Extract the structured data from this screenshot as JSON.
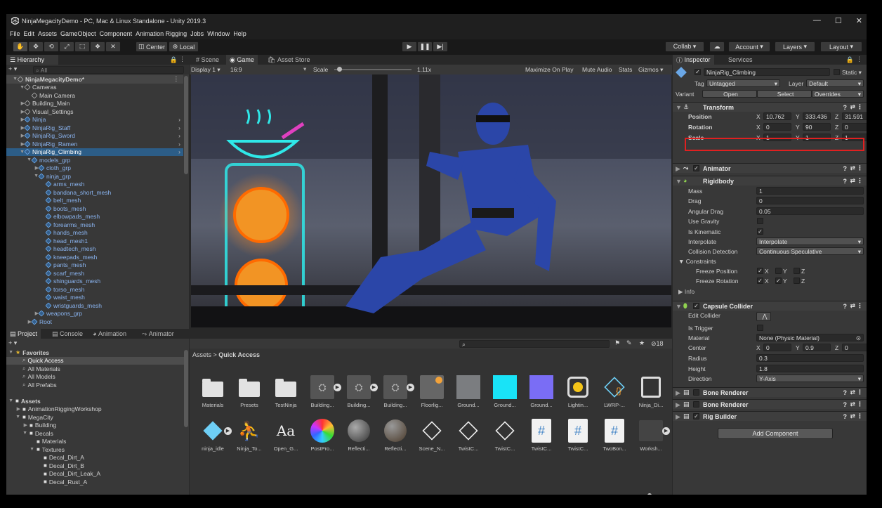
{
  "window": {
    "title": "NinjaMegacityDemo - PC, Mac & Linux Standalone - Unity 2019.3",
    "controls": [
      "—",
      "☐",
      "✕"
    ]
  },
  "menu": [
    "File",
    "Edit",
    "Assets",
    "GameObject",
    "Component",
    "Animation Rigging",
    "Jobs",
    "Window",
    "Help"
  ],
  "toolbar": {
    "pivot": "Center",
    "space": "Local",
    "collab": "Collab ▾",
    "account": "Account",
    "layers": "Layers",
    "layout": "Layout"
  },
  "hierarchy": {
    "tab": "Hierarchy",
    "search_placeholder": "All",
    "items": [
      {
        "label": "NinjaMegacityDemo*",
        "indent": 0,
        "bold": true,
        "arrow": "▼",
        "scene": true
      },
      {
        "label": "Cameras",
        "indent": 1,
        "arrow": "▼"
      },
      {
        "label": "Main Camera",
        "indent": 2,
        "arrow": ""
      },
      {
        "label": "Building_Main",
        "indent": 1,
        "arrow": "▶"
      },
      {
        "label": "Visual_Settings",
        "indent": 1,
        "arrow": "▶"
      },
      {
        "label": "Ninja",
        "indent": 1,
        "arrow": "▶",
        "blue": true,
        "more": true
      },
      {
        "label": "NinjaRig_Staff",
        "indent": 1,
        "arrow": "▶",
        "blue": true,
        "more": true
      },
      {
        "label": "NinjaRig_Sword",
        "indent": 1,
        "arrow": "▶",
        "blue": true,
        "more": true
      },
      {
        "label": "NinjaRig_Ramen",
        "indent": 1,
        "arrow": "▶",
        "blue": true,
        "more": true
      },
      {
        "label": "NinjaRig_Climbing",
        "indent": 1,
        "arrow": "▼",
        "blue": true,
        "selected": true,
        "more": true
      },
      {
        "label": "models_grp",
        "indent": 2,
        "arrow": "▼",
        "blue": true
      },
      {
        "label": "cloth_grp",
        "indent": 3,
        "arrow": "▶",
        "blue": true
      },
      {
        "label": "ninja_grp",
        "indent": 3,
        "arrow": "▼",
        "blue": true
      },
      {
        "label": "arms_mesh",
        "indent": 4,
        "arrow": "",
        "blue": true
      },
      {
        "label": "bandana_short_mesh",
        "indent": 4,
        "arrow": "",
        "blue": true
      },
      {
        "label": "belt_mesh",
        "indent": 4,
        "arrow": "",
        "blue": true
      },
      {
        "label": "boots_mesh",
        "indent": 4,
        "arrow": "",
        "blue": true
      },
      {
        "label": "elbowpads_mesh",
        "indent": 4,
        "arrow": "",
        "blue": true
      },
      {
        "label": "forearms_mesh",
        "indent": 4,
        "arrow": "",
        "blue": true
      },
      {
        "label": "hands_mesh",
        "indent": 4,
        "arrow": "",
        "blue": true
      },
      {
        "label": "head_mesh1",
        "indent": 4,
        "arrow": "",
        "blue": true
      },
      {
        "label": "headtech_mesh",
        "indent": 4,
        "arrow": "",
        "blue": true
      },
      {
        "label": "kneepads_mesh",
        "indent": 4,
        "arrow": "",
        "blue": true
      },
      {
        "label": "pants_mesh",
        "indent": 4,
        "arrow": "",
        "blue": true
      },
      {
        "label": "scarf_mesh",
        "indent": 4,
        "arrow": "",
        "blue": true
      },
      {
        "label": "shinguards_mesh",
        "indent": 4,
        "arrow": "",
        "blue": true
      },
      {
        "label": "torso_mesh",
        "indent": 4,
        "arrow": "",
        "blue": true
      },
      {
        "label": "waist_mesh",
        "indent": 4,
        "arrow": "",
        "blue": true
      },
      {
        "label": "wristguards_mesh",
        "indent": 4,
        "arrow": "",
        "blue": true
      },
      {
        "label": "weapons_grp",
        "indent": 3,
        "arrow": "▶",
        "blue": true
      },
      {
        "label": "Root",
        "indent": 2,
        "arrow": "▶",
        "blue": true
      }
    ]
  },
  "center_tabs": {
    "scene": "Scene",
    "game": "Game",
    "asset_store": "Asset Store"
  },
  "game_bar": {
    "display": "Display 1",
    "aspect": "16:9",
    "scale_label": "Scale",
    "scale_value": "1.11x",
    "maximize": "Maximize On Play",
    "mute": "Mute Audio",
    "stats": "Stats",
    "gizmos": "Gizmos"
  },
  "project": {
    "tabs": [
      "Project",
      "Console",
      "Animation",
      "Animator"
    ],
    "count": "18",
    "breadcrumb_root": "Assets",
    "breadcrumb_current": "Quick Access",
    "tree": [
      {
        "label": "Favorites",
        "indent": 0,
        "arrow": "▼",
        "star": true,
        "bold": true
      },
      {
        "label": "Quick Access",
        "indent": 1,
        "arrow": "",
        "selected": true
      },
      {
        "label": "All Materials",
        "indent": 1,
        "arrow": ""
      },
      {
        "label": "All Models",
        "indent": 1,
        "arrow": ""
      },
      {
        "label": "All Prefabs",
        "indent": 1,
        "arrow": ""
      },
      {
        "label": "",
        "indent": 0,
        "arrow": ""
      },
      {
        "label": "Assets",
        "indent": 0,
        "arrow": "▼",
        "bold": true,
        "folder": true
      },
      {
        "label": "AnimationRiggingWorkshop",
        "indent": 1,
        "arrow": "▶",
        "folder": true
      },
      {
        "label": "MegaCity",
        "indent": 1,
        "arrow": "▼",
        "folder": true
      },
      {
        "label": "Building",
        "indent": 2,
        "arrow": "▶",
        "folder": true
      },
      {
        "label": "Decals",
        "indent": 2,
        "arrow": "▼",
        "folder": true
      },
      {
        "label": "Materials",
        "indent": 3,
        "arrow": "",
        "folder": true
      },
      {
        "label": "Textures",
        "indent": 3,
        "arrow": "▼",
        "folder": true
      },
      {
        "label": "Decal_Dirt_A",
        "indent": 4,
        "arrow": "",
        "folder": true
      },
      {
        "label": "Decal_Dirt_B",
        "indent": 4,
        "arrow": "",
        "folder": true
      },
      {
        "label": "Decal_Dirt_Leak_A",
        "indent": 4,
        "arrow": "",
        "folder": true
      },
      {
        "label": "Decal_Rust_A",
        "indent": 4,
        "arrow": "",
        "folder": true
      }
    ],
    "assets_row1": [
      {
        "label": "Materials",
        "kind": "folder"
      },
      {
        "label": "Presets",
        "kind": "folder"
      },
      {
        "label": "TestNinja",
        "kind": "folder"
      },
      {
        "label": "Building...",
        "kind": "thumb-dark",
        "play": true
      },
      {
        "label": "Building...",
        "kind": "thumb-dark",
        "play": true
      },
      {
        "label": "Building...",
        "kind": "thumb-dark",
        "play": true
      },
      {
        "label": "Floorlig...",
        "kind": "thumb-floor"
      },
      {
        "label": "Ground...",
        "kind": "thumb-gray"
      },
      {
        "label": "Ground...",
        "kind": "thumb-cyan"
      },
      {
        "label": "Ground...",
        "kind": "thumb-violet"
      },
      {
        "label": "Lightin...",
        "kind": "thumb-light"
      },
      {
        "label": "LWRP-...",
        "kind": "thumb-lwrp"
      },
      {
        "label": "Ninja_Di...",
        "kind": "thumb-film"
      }
    ],
    "assets_row2": [
      {
        "label": "ninja_idle",
        "kind": "thumb-cube",
        "play": true
      },
      {
        "label": "Ninja_To...",
        "kind": "thumb-avatar"
      },
      {
        "label": "Open_G...",
        "kind": "thumb-font"
      },
      {
        "label": "PostPro...",
        "kind": "thumb-wheel"
      },
      {
        "label": "Reflecti...",
        "kind": "thumb-sphere"
      },
      {
        "label": "Reflecti...",
        "kind": "thumb-sphere2"
      },
      {
        "label": "Scene_N...",
        "kind": "thumb-unity"
      },
      {
        "label": "TwistC...",
        "kind": "thumb-unity"
      },
      {
        "label": "TwistC...",
        "kind": "thumb-unity"
      },
      {
        "label": "TwistC...",
        "kind": "thumb-hash"
      },
      {
        "label": "TwistC...",
        "kind": "thumb-hash"
      },
      {
        "label": "TwoBon...",
        "kind": "thumb-hash"
      },
      {
        "label": "Worksh...",
        "kind": "thumb-scene",
        "play": true
      }
    ]
  },
  "inspector": {
    "tabs": [
      "Inspector",
      "Services"
    ],
    "object_name": "NinjaRig_Climbing",
    "static_label": "Static",
    "tag_label": "Tag",
    "tag_value": "Untagged",
    "layer_label": "Layer",
    "layer_value": "Default",
    "variant_label": "Variant",
    "open_btn": "Open",
    "select_btn": "Select",
    "overrides": "Overrides",
    "transform": {
      "title": "Transform",
      "position_label": "Position",
      "rotation_label": "Rotation",
      "scale_label": "Scale",
      "position": [
        "10.762",
        "333.436",
        "31.591"
      ],
      "rotation": [
        "0",
        "90",
        "0"
      ],
      "scale": [
        "1",
        "1",
        "1"
      ]
    },
    "animator_title": "Animator",
    "rigidbody": {
      "title": "Rigidbody",
      "rows": [
        {
          "label": "Mass",
          "value": "1",
          "type": "field"
        },
        {
          "label": "Drag",
          "value": "0",
          "type": "field"
        },
        {
          "label": "Angular Drag",
          "value": "0.05",
          "type": "field"
        },
        {
          "label": "Use Gravity",
          "value": "",
          "type": "check"
        },
        {
          "label": "Is Kinematic",
          "value": "✓",
          "type": "check"
        },
        {
          "label": "Interpolate",
          "value": "Interpolate",
          "type": "dropdown"
        },
        {
          "label": "Collision Detection",
          "value": "Continuous Speculative",
          "type": "dropdown"
        }
      ],
      "constraints": "Constraints",
      "freeze_position": "Freeze Position",
      "freeze_rotation": "Freeze Rotation",
      "info": "Info"
    },
    "capsule": {
      "title": "Capsule Collider",
      "edit_collider": "Edit Collider",
      "is_trigger": "Is Trigger",
      "material_label": "Material",
      "material_value": "None (Physic Material)",
      "center_label": "Center",
      "center": [
        "0",
        "0.9",
        "0"
      ],
      "radius_label": "Radius",
      "radius": "0.3",
      "height_label": "Height",
      "height": "1.8",
      "direction_label": "Direction",
      "direction": "Y-Axis"
    },
    "bone_renderer_1": "Bone Renderer",
    "bone_renderer_2": "Bone Renderer",
    "rig_builder": "Rig Builder",
    "add_component": "Add Component"
  },
  "axes": {
    "x": "X",
    "y": "Y",
    "z": "Z"
  },
  "colors": {
    "highlight": "#e02020",
    "selection": "#2c5d87",
    "accent_blue": "#8ab4f0"
  }
}
